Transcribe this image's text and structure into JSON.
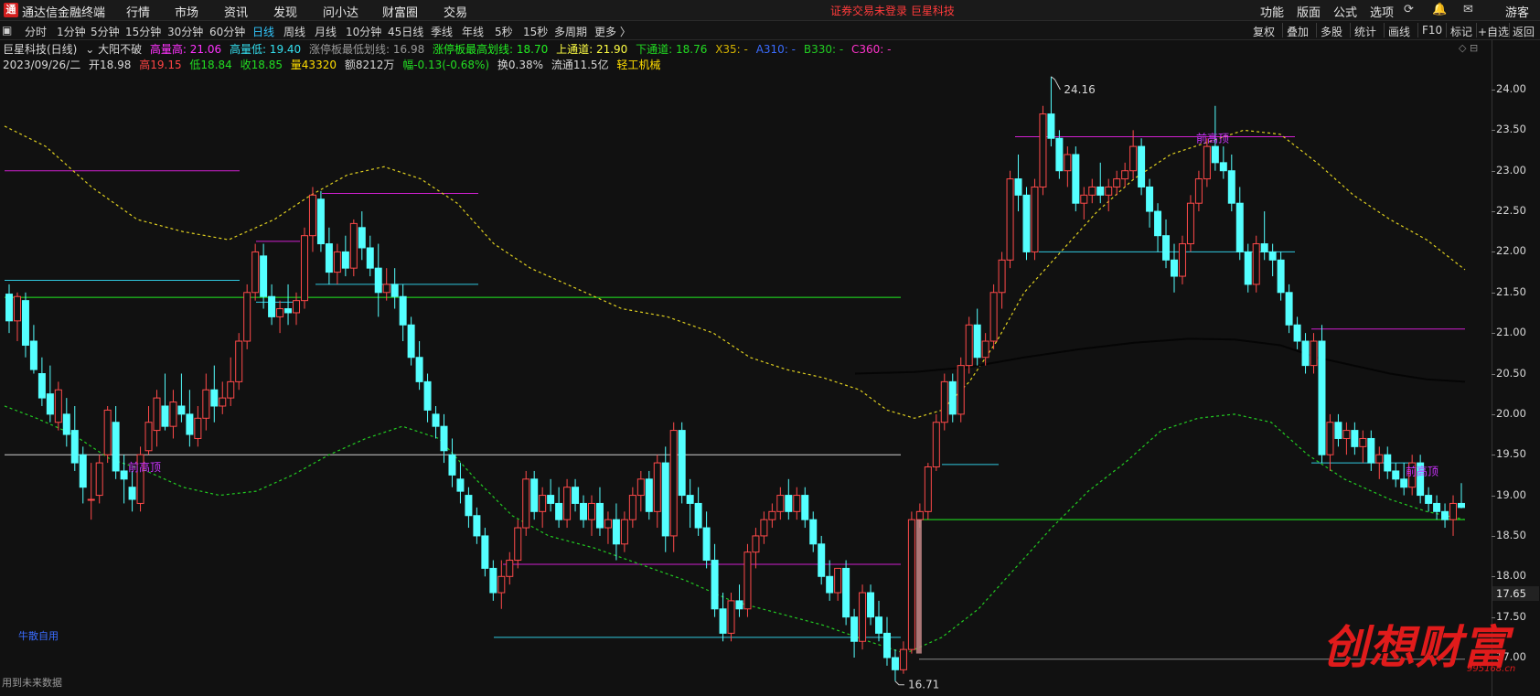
{
  "app": {
    "title": "通达信金融终端",
    "logo": "通"
  },
  "menu": [
    "行情",
    "市场",
    "资讯",
    "发现",
    "问小达",
    "财富圈",
    "交易"
  ],
  "warning": "证券交易未登录  巨星科技",
  "right_menu": [
    "功能",
    "版面",
    "公式",
    "选项"
  ],
  "right_icons": [
    "sync-icon",
    "bell-icon",
    "mail-icon"
  ],
  "guest": "游客",
  "toolbar": {
    "periods": [
      "分时",
      "1分钟",
      "5分钟",
      "15分钟",
      "30分钟",
      "60分钟",
      "日线",
      "周线",
      "月线",
      "10分钟",
      "45日线",
      "季线",
      "年线",
      "5秒",
      "15秒",
      "多周期",
      "更多 〉"
    ],
    "active": "日线",
    "right": [
      "复权",
      "叠加",
      "多股",
      "统计",
      "画线",
      "F10",
      "标记",
      "+自选",
      "返回"
    ]
  },
  "info_line1": [
    {
      "t": "巨星科技(日线)",
      "c": "#d8d8d8"
    },
    {
      "t": "⌄ 大阳不破",
      "c": "#d8d8d8"
    },
    {
      "t": "高量高: 21.06",
      "c": "#ff33ff"
    },
    {
      "t": "高量低: 19.40",
      "c": "#34e0f0"
    },
    {
      "t": "涨停板最低划线: 16.98",
      "c": "#9a9a9a"
    },
    {
      "t": "涨停板最高划线: 18.70",
      "c": "#22ee22"
    },
    {
      "t": "上通道: 21.90",
      "c": "#ffff44"
    },
    {
      "t": "下通道: 18.76",
      "c": "#22dd22"
    },
    {
      "t": "X35: -",
      "c": "#d6b400"
    },
    {
      "t": "A310: -",
      "c": "#3a6cff"
    },
    {
      "t": "B330: -",
      "c": "#22cc22"
    },
    {
      "t": "C360: -",
      "c": "#ff33cc"
    }
  ],
  "info_line2": [
    {
      "t": "2023/09/26/二",
      "c": "#d8d8d8"
    },
    {
      "t": "开18.98",
      "c": "#d8d8d8"
    },
    {
      "t": "高19.15",
      "c": "#ff4444"
    },
    {
      "t": "低18.84",
      "c": "#22dd22"
    },
    {
      "t": "收18.85",
      "c": "#22dd22"
    },
    {
      "t": "量43320",
      "c": "#ffdd00"
    },
    {
      "t": "额8212万",
      "c": "#d8d8d8"
    },
    {
      "t": "幅-0.13(-0.68%)",
      "c": "#22dd22"
    },
    {
      "t": "换0.38%",
      "c": "#d8d8d8"
    },
    {
      "t": "流通11.5亿",
      "c": "#d8d8d8"
    },
    {
      "t": "轻工机械",
      "c": "#ffdd00"
    }
  ],
  "axis": {
    "ticks": [
      "24.00",
      "23.50",
      "23.00",
      "22.50",
      "22.00",
      "21.50",
      "21.00",
      "20.50",
      "20.00",
      "19.50",
      "19.00",
      "18.50",
      "18.00",
      "17.50",
      "17.00"
    ],
    "current": "17.65"
  },
  "chart_data": {
    "type": "candlestick",
    "ylim": [
      16.5,
      24.4
    ],
    "ohlc": [
      [
        21.48,
        21.6,
        21.0,
        21.15
      ],
      [
        21.15,
        21.5,
        20.9,
        21.45
      ],
      [
        21.4,
        21.5,
        20.7,
        20.85
      ],
      [
        20.9,
        21.1,
        20.5,
        20.55
      ],
      [
        20.5,
        20.7,
        20.1,
        20.2
      ],
      [
        20.25,
        20.6,
        19.9,
        20.0
      ],
      [
        19.9,
        20.4,
        19.8,
        20.3
      ],
      [
        20.0,
        20.2,
        19.6,
        19.75
      ],
      [
        19.8,
        20.1,
        19.3,
        19.4
      ],
      [
        19.5,
        19.6,
        18.9,
        19.1
      ],
      [
        18.95,
        19.4,
        18.7,
        18.95
      ],
      [
        19.0,
        19.5,
        18.9,
        19.4
      ],
      [
        19.5,
        20.1,
        19.4,
        20.05
      ],
      [
        19.9,
        20.1,
        19.2,
        19.3
      ],
      [
        19.3,
        19.5,
        18.9,
        19.2
      ],
      [
        19.1,
        19.3,
        18.8,
        18.95
      ],
      [
        18.9,
        19.6,
        18.8,
        19.5
      ],
      [
        19.55,
        20.1,
        19.5,
        19.9
      ],
      [
        19.8,
        20.3,
        19.6,
        20.2
      ],
      [
        20.1,
        20.5,
        19.8,
        19.85
      ],
      [
        19.85,
        20.3,
        19.7,
        20.15
      ],
      [
        20.1,
        20.5,
        19.9,
        20.0
      ],
      [
        20.0,
        20.3,
        19.6,
        19.75
      ],
      [
        19.7,
        20.1,
        19.6,
        19.95
      ],
      [
        19.95,
        20.5,
        19.8,
        20.3
      ],
      [
        20.3,
        20.6,
        19.9,
        20.1
      ],
      [
        20.1,
        20.4,
        20.0,
        20.2
      ],
      [
        20.2,
        20.7,
        20.1,
        20.4
      ],
      [
        20.4,
        21.0,
        20.3,
        20.9
      ],
      [
        20.9,
        21.6,
        20.8,
        21.5
      ],
      [
        21.5,
        22.1,
        21.4,
        22.0
      ],
      [
        21.95,
        22.1,
        21.3,
        21.45
      ],
      [
        21.45,
        21.6,
        21.1,
        21.2
      ],
      [
        21.2,
        21.4,
        21.0,
        21.3
      ],
      [
        21.3,
        21.6,
        21.1,
        21.25
      ],
      [
        21.25,
        21.5,
        21.1,
        21.4
      ],
      [
        21.4,
        22.3,
        21.3,
        22.2
      ],
      [
        22.2,
        22.8,
        22.0,
        22.7
      ],
      [
        22.65,
        22.75,
        22.0,
        22.1
      ],
      [
        22.1,
        22.3,
        21.6,
        21.75
      ],
      [
        21.75,
        22.1,
        21.6,
        22.0
      ],
      [
        22.0,
        22.2,
        21.7,
        21.8
      ],
      [
        21.8,
        22.4,
        21.7,
        22.35
      ],
      [
        22.3,
        22.5,
        21.9,
        22.05
      ],
      [
        22.05,
        22.2,
        21.7,
        21.8
      ],
      [
        21.8,
        22.1,
        21.2,
        21.5
      ],
      [
        21.5,
        21.8,
        21.4,
        21.6
      ],
      [
        21.6,
        21.8,
        21.3,
        21.45
      ],
      [
        21.45,
        21.6,
        20.9,
        21.1
      ],
      [
        21.1,
        21.2,
        20.6,
        20.7
      ],
      [
        20.7,
        20.9,
        20.3,
        20.4
      ],
      [
        20.4,
        20.5,
        19.9,
        20.05
      ],
      [
        20.0,
        20.1,
        19.7,
        19.85
      ],
      [
        19.85,
        20.0,
        19.4,
        19.55
      ],
      [
        19.5,
        19.7,
        19.1,
        19.25
      ],
      [
        19.2,
        19.4,
        18.9,
        19.05
      ],
      [
        19.0,
        19.1,
        18.6,
        18.75
      ],
      [
        18.75,
        18.85,
        18.4,
        18.5
      ],
      [
        18.5,
        18.6,
        18.0,
        18.1
      ],
      [
        18.1,
        18.2,
        17.7,
        17.8
      ],
      [
        17.8,
        18.2,
        17.6,
        18.0
      ],
      [
        18.0,
        18.3,
        17.9,
        18.2
      ],
      [
        18.2,
        18.7,
        18.1,
        18.6
      ],
      [
        18.6,
        19.3,
        18.5,
        19.2
      ],
      [
        19.2,
        19.3,
        18.7,
        18.8
      ],
      [
        18.8,
        19.1,
        18.6,
        19.0
      ],
      [
        19.0,
        19.2,
        18.8,
        18.9
      ],
      [
        18.9,
        19.1,
        18.6,
        18.7
      ],
      [
        18.7,
        19.2,
        18.6,
        19.1
      ],
      [
        19.1,
        19.2,
        18.8,
        18.9
      ],
      [
        18.9,
        19.0,
        18.6,
        18.7
      ],
      [
        18.7,
        19.0,
        18.5,
        18.9
      ],
      [
        18.9,
        19.1,
        18.5,
        18.6
      ],
      [
        18.6,
        18.8,
        18.4,
        18.7
      ],
      [
        18.7,
        18.9,
        18.2,
        18.4
      ],
      [
        18.4,
        18.8,
        18.3,
        18.7
      ],
      [
        18.7,
        19.1,
        18.6,
        19.0
      ],
      [
        19.0,
        19.3,
        18.8,
        19.2
      ],
      [
        19.2,
        19.3,
        18.7,
        18.8
      ],
      [
        18.8,
        19.5,
        18.6,
        19.4
      ],
      [
        19.4,
        19.6,
        18.3,
        18.5
      ],
      [
        18.5,
        19.9,
        18.3,
        19.8
      ],
      [
        19.8,
        19.9,
        18.9,
        19.0
      ],
      [
        19.0,
        19.2,
        18.6,
        18.9
      ],
      [
        18.9,
        19.1,
        18.5,
        18.6
      ],
      [
        18.6,
        18.8,
        18.1,
        18.2
      ],
      [
        18.2,
        18.4,
        17.5,
        17.6
      ],
      [
        17.6,
        17.8,
        17.2,
        17.3
      ],
      [
        17.3,
        17.8,
        17.2,
        17.7
      ],
      [
        17.7,
        17.9,
        17.5,
        17.6
      ],
      [
        17.6,
        18.4,
        17.5,
        18.3
      ],
      [
        18.3,
        18.6,
        18.1,
        18.5
      ],
      [
        18.5,
        18.8,
        18.4,
        18.7
      ],
      [
        18.7,
        18.9,
        18.6,
        18.8
      ],
      [
        18.8,
        19.1,
        18.7,
        19.0
      ],
      [
        19.0,
        19.2,
        18.7,
        18.8
      ],
      [
        18.8,
        19.1,
        18.7,
        19.0
      ],
      [
        19.0,
        19.1,
        18.6,
        18.7
      ],
      [
        18.7,
        18.8,
        18.3,
        18.4
      ],
      [
        18.4,
        18.5,
        17.9,
        18.0
      ],
      [
        18.0,
        18.2,
        17.7,
        17.8
      ],
      [
        17.8,
        18.1,
        17.7,
        18.1
      ],
      [
        18.1,
        18.2,
        17.4,
        17.5
      ],
      [
        17.5,
        17.6,
        17.0,
        17.2
      ],
      [
        17.2,
        17.9,
        17.1,
        17.8
      ],
      [
        17.8,
        17.9,
        17.4,
        17.5
      ],
      [
        17.5,
        17.7,
        17.2,
        17.3
      ],
      [
        17.3,
        17.5,
        16.9,
        17.0
      ],
      [
        17.0,
        17.1,
        16.71,
        16.85
      ],
      [
        16.85,
        17.2,
        16.8,
        17.1
      ],
      [
        17.1,
        18.8,
        17.05,
        18.7
      ],
      [
        18.7,
        18.9,
        18.6,
        18.8
      ],
      [
        18.8,
        19.4,
        18.7,
        19.35
      ],
      [
        19.35,
        20.0,
        19.3,
        19.9
      ],
      [
        19.9,
        20.5,
        19.8,
        20.4
      ],
      [
        20.4,
        20.5,
        19.9,
        20.0
      ],
      [
        20.0,
        20.7,
        19.9,
        20.6
      ],
      [
        20.6,
        21.2,
        20.5,
        21.1
      ],
      [
        21.1,
        21.3,
        20.6,
        20.7
      ],
      [
        20.7,
        21.0,
        20.6,
        20.9
      ],
      [
        20.9,
        21.6,
        20.8,
        21.5
      ],
      [
        21.5,
        22.0,
        21.3,
        21.9
      ],
      [
        21.9,
        23.0,
        21.8,
        22.9
      ],
      [
        22.9,
        23.2,
        22.5,
        22.7
      ],
      [
        22.7,
        22.8,
        21.9,
        22.0
      ],
      [
        22.0,
        22.9,
        21.9,
        22.8
      ],
      [
        22.8,
        23.8,
        22.7,
        23.7
      ],
      [
        23.7,
        24.16,
        23.3,
        23.4
      ],
      [
        23.4,
        23.5,
        22.9,
        23.0
      ],
      [
        23.0,
        23.3,
        22.8,
        23.2
      ],
      [
        23.2,
        23.3,
        22.5,
        22.6
      ],
      [
        22.6,
        22.8,
        22.4,
        22.7
      ],
      [
        22.7,
        22.9,
        22.6,
        22.8
      ],
      [
        22.8,
        23.1,
        22.6,
        22.7
      ],
      [
        22.7,
        22.9,
        22.5,
        22.8
      ],
      [
        22.8,
        23.0,
        22.7,
        22.9
      ],
      [
        22.9,
        23.1,
        22.8,
        23.0
      ],
      [
        23.0,
        23.5,
        22.9,
        23.3
      ],
      [
        23.3,
        23.4,
        22.7,
        22.8
      ],
      [
        22.8,
        22.9,
        22.3,
        22.5
      ],
      [
        22.5,
        22.6,
        22.0,
        22.2
      ],
      [
        22.2,
        22.4,
        21.8,
        21.9
      ],
      [
        21.9,
        22.1,
        21.5,
        21.7
      ],
      [
        21.7,
        22.2,
        21.6,
        22.1
      ],
      [
        22.1,
        22.7,
        22.0,
        22.6
      ],
      [
        22.6,
        23.0,
        22.5,
        22.9
      ],
      [
        22.9,
        23.4,
        22.8,
        23.3
      ],
      [
        23.3,
        23.8,
        23.0,
        23.1
      ],
      [
        23.1,
        23.3,
        22.9,
        23.0
      ],
      [
        23.0,
        23.2,
        22.5,
        22.6
      ],
      [
        22.6,
        22.8,
        21.9,
        22.0
      ],
      [
        22.0,
        22.1,
        21.5,
        21.6
      ],
      [
        21.6,
        22.2,
        21.5,
        22.1
      ],
      [
        22.1,
        22.5,
        21.9,
        22.0
      ],
      [
        22.0,
        22.1,
        21.7,
        21.9
      ],
      [
        21.9,
        22.0,
        21.4,
        21.5
      ],
      [
        21.5,
        21.6,
        21.0,
        21.1
      ],
      [
        21.1,
        21.2,
        20.8,
        20.9
      ],
      [
        20.9,
        21.0,
        20.5,
        20.6
      ],
      [
        20.6,
        21.0,
        20.5,
        20.9
      ],
      [
        20.9,
        21.1,
        19.4,
        19.5
      ],
      [
        19.5,
        20.0,
        19.3,
        19.9
      ],
      [
        19.9,
        20.0,
        19.6,
        19.7
      ],
      [
        19.7,
        19.9,
        19.5,
        19.8
      ],
      [
        19.8,
        19.9,
        19.5,
        19.6
      ],
      [
        19.6,
        19.8,
        19.4,
        19.7
      ],
      [
        19.7,
        19.8,
        19.3,
        19.4
      ],
      [
        19.4,
        19.6,
        19.2,
        19.5
      ],
      [
        19.5,
        19.6,
        19.2,
        19.3
      ],
      [
        19.3,
        19.4,
        19.1,
        19.2
      ],
      [
        19.2,
        19.4,
        19.0,
        19.1
      ],
      [
        19.1,
        19.5,
        19.0,
        19.4
      ],
      [
        19.4,
        19.5,
        18.9,
        19.0
      ],
      [
        19.0,
        19.1,
        18.8,
        18.9
      ],
      [
        18.9,
        19.0,
        18.7,
        18.8
      ],
      [
        18.8,
        18.9,
        18.6,
        18.7
      ],
      [
        18.7,
        19.0,
        18.5,
        18.9
      ],
      [
        18.9,
        19.15,
        18.84,
        18.85
      ]
    ],
    "annotations": {
      "high": "24.16",
      "low": "16.71"
    },
    "labels": [
      "前高顶",
      "前高顶",
      "前高顶",
      "前高顶"
    ]
  },
  "hints": {
    "left_blue": "牛散自用",
    "bottom": "用到未来数据"
  },
  "watermark": {
    "text": "创想财富",
    "url": "995168.cn"
  }
}
